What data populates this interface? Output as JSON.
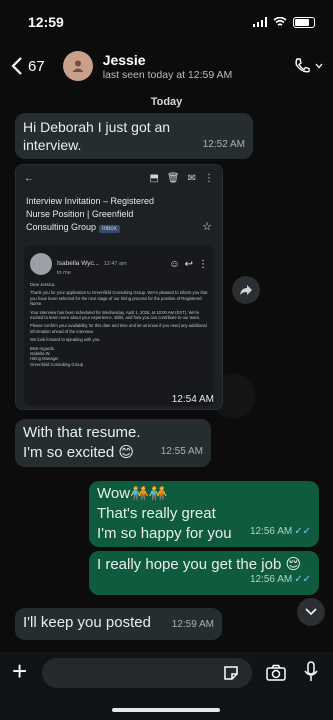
{
  "status": {
    "time": "12:59"
  },
  "header": {
    "back_count": "67",
    "contact_name": "Jessie",
    "contact_status": "last seen today at 12:59 AM"
  },
  "day_label": "Today",
  "messages": [
    {
      "text": "Hi Deborah I just got an interview.",
      "time": "12:52 AM"
    },
    {
      "text": "With that resume.",
      "text2": "I'm so excited 😊",
      "time": "12:55 AM"
    },
    {
      "text": "Wow🧑‍🤝‍🧑🧑‍🤝‍🧑",
      "text2": "That's really great",
      "text3": "I'm so happy for you",
      "time": "12:56 AM"
    },
    {
      "text": "I really hope you get the job 😌",
      "time": "12:56 AM"
    },
    {
      "text": "I'll keep you posted",
      "time": "12:59 AM"
    }
  ],
  "email": {
    "subject_line1": "Interview Invitation – Registered",
    "subject_line2": "Nurse Position | Greenfield",
    "subject_line3": "Consulting Group",
    "inbox_label": "Inbox",
    "sender_name": "Isabella Wyc...",
    "sender_time": "12:47 am",
    "to": "to me",
    "greeting": "Dear Jessica,",
    "p1": "Thank you for your application to Greenfield Consulting Group. We're pleased to inform you that you have been selected for the next stage of our hiring process for the position of Registered Nurse.",
    "p2": "Your interview has been scheduled for Wednesday, April 1, 2026, at 10:00 AM (EST). We're excited to learn more about your experience, skills, and how you can contribute to our team.",
    "p3": "Please confirm your availability for this date and time and let us know if you need any additional information ahead of the interview.",
    "p4": "We look forward to speaking with you.",
    "sign1": "Best regards,",
    "sign2": "Isabella W.",
    "sign3": "Hiring Manager",
    "sign4": "Greenfield Consulting Group",
    "time": "12:54 AM"
  },
  "colors": {
    "incoming": "#262d31",
    "outgoing": "#0f5b3e",
    "background": "#0c0c0c"
  }
}
